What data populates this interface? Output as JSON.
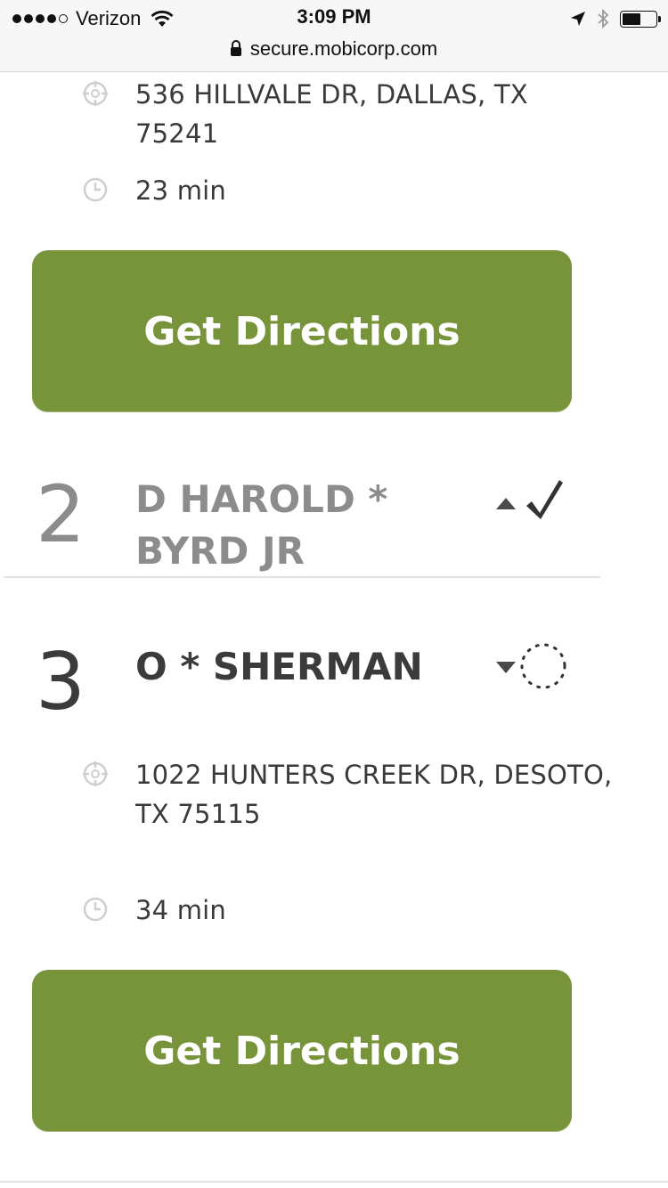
{
  "status_bar": {
    "carrier": "Verizon",
    "time": "3:09 PM",
    "url": "secure.mobicorp.com",
    "icons": [
      "signal-dots",
      "wifi-icon",
      "location-arrow-icon",
      "bluetooth-icon",
      "battery-icon"
    ]
  },
  "stop1": {
    "address": "536 HILLVALE DR, DALLAS, TX 75241",
    "duration": "23 min",
    "button_label": "Get Directions"
  },
  "stop2": {
    "number": "2",
    "name_line1": "D HAROLD *",
    "name_line2": "BYRD JR",
    "status": "completed",
    "expand": "collapsed-up"
  },
  "stop3": {
    "number": "3",
    "name": "O * SHERMAN",
    "address_line1": "1022 HUNTERS CREEK DR, DESOTO,",
    "address_line2": "TX 75115",
    "duration": "34 min",
    "button_label": "Get Directions",
    "status": "pending",
    "expand": "expanded-down"
  },
  "colors": {
    "button": "#78943b",
    "done_text": "#8c8c8c",
    "active_text": "#3b3b3b",
    "icon_gray": "#cfcfcf"
  }
}
